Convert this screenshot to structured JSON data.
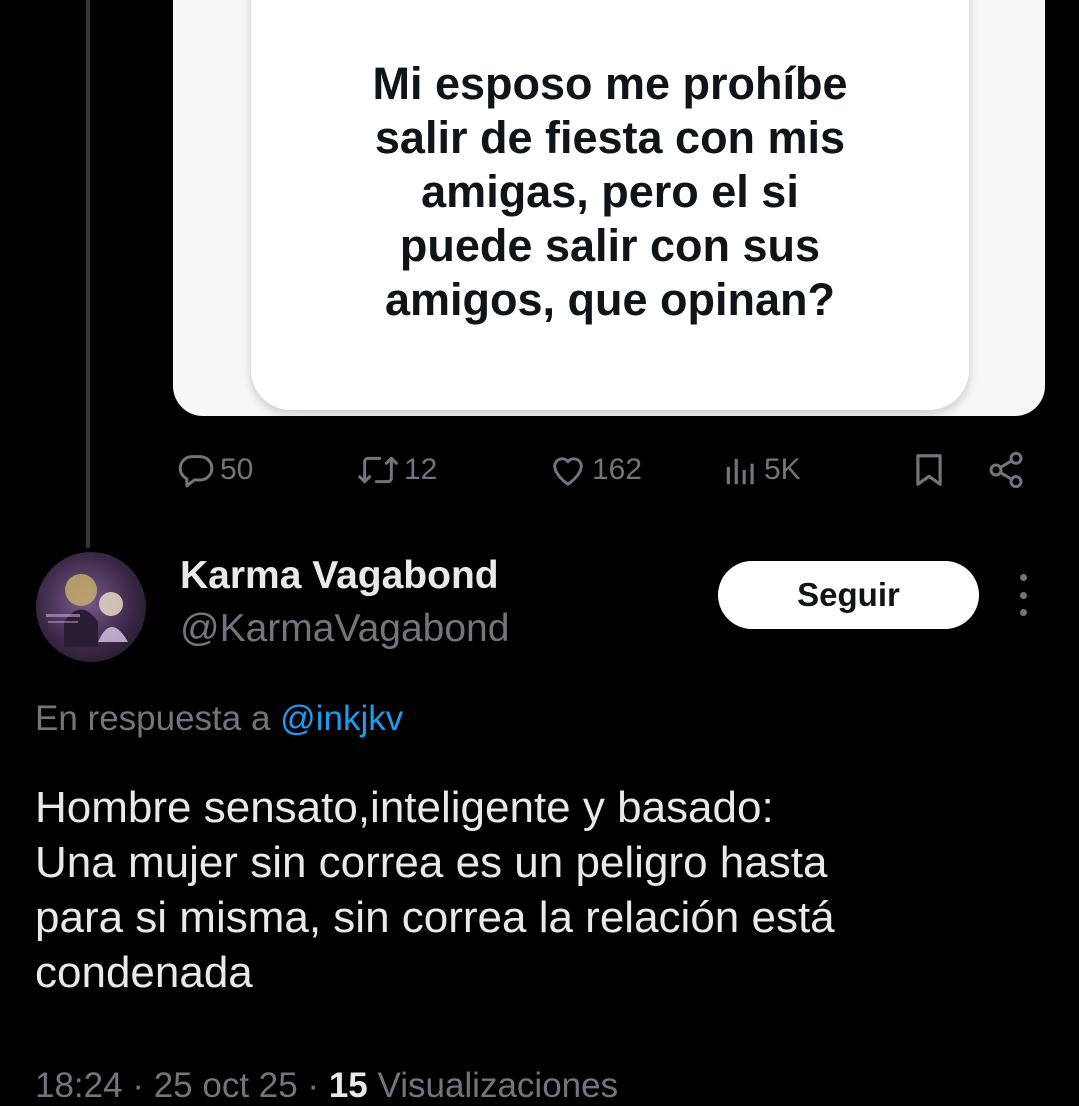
{
  "quoted_media": {
    "text": "Mi esposo me prohíbe\nsalir de fiesta con mis\namigas, pero el si\npuede salir con sus\namigos, que opinan?"
  },
  "actions": {
    "replies": {
      "icon": "reply-bubble-icon",
      "count": "50"
    },
    "retweets": {
      "icon": "retweet-icon",
      "count": "12"
    },
    "likes": {
      "icon": "heart-icon",
      "count": "162"
    },
    "views": {
      "icon": "views-bars-icon",
      "count": "5K"
    },
    "bookmark": {
      "icon": "bookmark-icon"
    },
    "share": {
      "icon": "share-icon"
    }
  },
  "author": {
    "display_name": "Karma Vagabond",
    "handle": "@KarmaVagabond"
  },
  "follow_button": {
    "label": "Seguir"
  },
  "reply_context": {
    "prefix": "En respuesta a",
    "mention": "@inkjkv"
  },
  "tweet": {
    "text": "Hombre sensato,inteligente y basado:\nUna mujer sin correa es un peligro hasta\npara si misma, sin correa la relación está\ncondenada"
  },
  "meta": {
    "time": "18:24",
    "date": "25 oct 25",
    "views_count": "15",
    "views_label": "Visualizaciones"
  },
  "colors": {
    "background": "#000000",
    "text_primary": "#e7e9ea",
    "text_secondary": "#71767b",
    "accent": "#1d9bf0",
    "button_bg": "#ffffff"
  }
}
